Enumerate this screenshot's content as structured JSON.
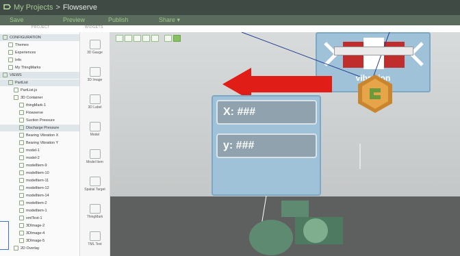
{
  "breadcrumb": {
    "root": "My Projects",
    "separator": ">",
    "project": "Flowserve"
  },
  "toolbar": {
    "save": "Save",
    "preview": "Preview",
    "publish": "Publish",
    "share": "Share ▾"
  },
  "sections": {
    "project": "PROJECT",
    "widgets": "WIDGETS"
  },
  "tree": [
    {
      "label": "CONFIGURATION",
      "indent": 0,
      "hl": true
    },
    {
      "label": "Themes",
      "indent": 1
    },
    {
      "label": "Experiences",
      "indent": 1
    },
    {
      "label": "Info",
      "indent": 1
    },
    {
      "label": "My ThingMarks",
      "indent": 1
    },
    {
      "label": "VIEWS",
      "indent": 0,
      "hl": true
    },
    {
      "label": "PartList",
      "indent": 1,
      "hl": true
    },
    {
      "label": "PartList.js",
      "indent": 2
    },
    {
      "label": "3D Container",
      "indent": 2
    },
    {
      "label": "thingMark-1",
      "indent": 3
    },
    {
      "label": "Flowserve",
      "indent": 3
    },
    {
      "label": "Suction Pressure",
      "indent": 3
    },
    {
      "label": "Discharge Pressure",
      "indent": 3,
      "hl": true
    },
    {
      "label": "Bearing Vibration X",
      "indent": 3
    },
    {
      "label": "Bearing Vibration Y",
      "indent": 3
    },
    {
      "label": "model-1",
      "indent": 3
    },
    {
      "label": "model-2",
      "indent": 3
    },
    {
      "label": "modelItem-9",
      "indent": 3
    },
    {
      "label": "modelItem-10",
      "indent": 3
    },
    {
      "label": "modelItem-11",
      "indent": 3
    },
    {
      "label": "modelItem-12",
      "indent": 3
    },
    {
      "label": "modelItem-14",
      "indent": 3
    },
    {
      "label": "modelItem-2",
      "indent": 3
    },
    {
      "label": "modelItem-1",
      "indent": 3
    },
    {
      "label": "xmlText-1",
      "indent": 3
    },
    {
      "label": "3DImage-2",
      "indent": 3
    },
    {
      "label": "3DImage-4",
      "indent": 3
    },
    {
      "label": "3DImage-5",
      "indent": 3
    },
    {
      "label": "2D Overlay",
      "indent": 2
    }
  ],
  "widgets": [
    {
      "label": "3D Gauge",
      "icon": "gauge-icon"
    },
    {
      "label": "3D Image",
      "icon": "image-icon"
    },
    {
      "label": "3D Label",
      "icon": "label-icon"
    },
    {
      "label": "Model",
      "icon": "model-icon"
    },
    {
      "label": "Model Item",
      "icon": "model-item-icon"
    },
    {
      "label": "Spatial Target",
      "icon": "spatial-target-icon"
    },
    {
      "label": "ThingMark",
      "icon": "thingmark-icon"
    },
    {
      "label": "TML Text",
      "icon": "tml-text-icon"
    }
  ],
  "canvas": {
    "vibration_label": "vibration",
    "x_value": "X: ###",
    "y_value": "y: ###"
  }
}
